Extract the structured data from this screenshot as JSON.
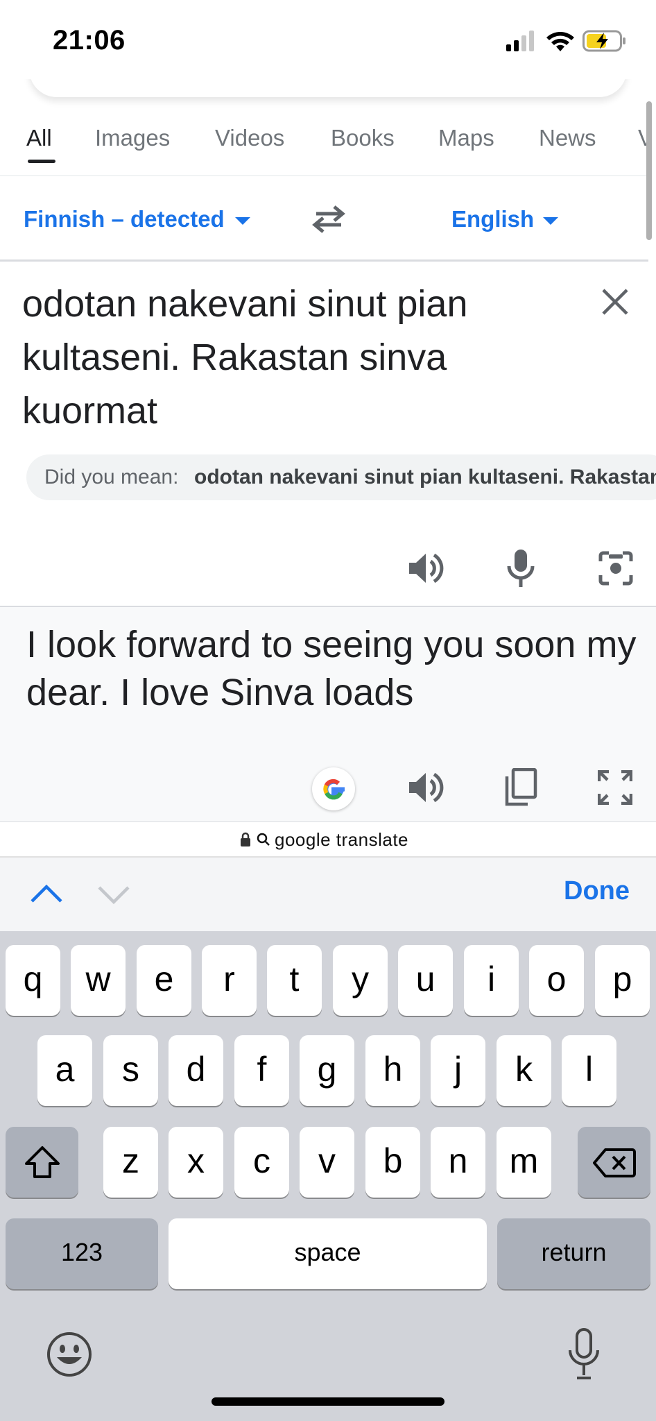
{
  "status_bar": {
    "time": "21:06"
  },
  "tabs": [
    {
      "label": "All",
      "active": true
    },
    {
      "label": "Images"
    },
    {
      "label": "Videos"
    },
    {
      "label": "Books"
    },
    {
      "label": "Maps"
    },
    {
      "label": "News"
    },
    {
      "label": "V"
    }
  ],
  "translate": {
    "source_language": "Finnish – detected",
    "target_language": "English",
    "source_text": "odotan nakevani sinut pian kultaseni. Rakastan sinva kuormat",
    "did_you_mean_label": "Did you mean:",
    "did_you_mean_value": "odotan nakevani sinut pian kultaseni. Rakastan",
    "translation": "I look forward to seeing you soon my dear. I love Sinva loads"
  },
  "url_bar": {
    "text": "google translate"
  },
  "keyboard_toolbar": {
    "done_label": "Done"
  },
  "keyboard": {
    "row1": [
      "q",
      "w",
      "e",
      "r",
      "t",
      "y",
      "u",
      "i",
      "o",
      "p"
    ],
    "row2": [
      "a",
      "s",
      "d",
      "f",
      "g",
      "h",
      "j",
      "k",
      "l"
    ],
    "row3": [
      "z",
      "x",
      "c",
      "v",
      "b",
      "n",
      "m"
    ],
    "numbers_label": "123",
    "space_label": "space",
    "return_label": "return"
  },
  "colors": {
    "accent": "#1a73e8",
    "keyboard_bg": "#d1d3d9"
  }
}
